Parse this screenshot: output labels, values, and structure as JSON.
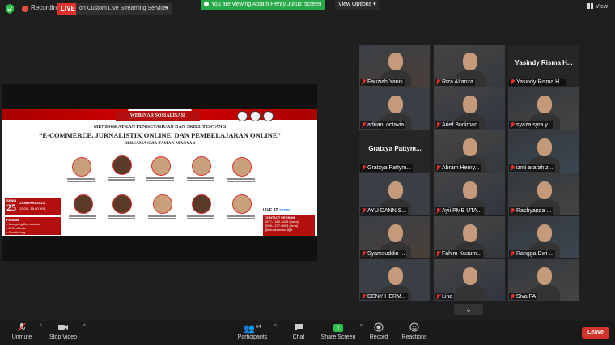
{
  "topbar": {
    "recording_label": "Recording",
    "live_badge": "LIVE",
    "live_service": "on Custom Live Streaming Service",
    "viewing_banner": "You are viewing Abram Henry Julius' screen",
    "view_options": "View Options",
    "view_label": "View"
  },
  "poster": {
    "badge": "WEBINAR SOSIALISASI",
    "line1": "MENINGKATKAN PENGETAHUAN DAN SKILL TENTANG",
    "line2": "“E-COMMERCE, JURNALISTIK ONLINE, DAN PEMBELAJARAN ONLINE”",
    "line3": "BERSAMA SMA TAMAN MADYA 1",
    "senin": "SENIN",
    "day": "25",
    "month": "JANUARI 2021",
    "time": "13.00 - 15.00 WIB",
    "fasilitas_title": "Fasilitas",
    "fasilitas": [
      "Ilmu yang Bermanfaat",
      "E-Certificate",
      "Goodie bag"
    ],
    "live_at": "LIVE AT",
    "zoom": "zoom",
    "contact_title": "CONTACT PERSON",
    "contact_lines": [
      "0877-7410-4405 (Juria)",
      "0895-1277-0505 (Irma)",
      "@himakomsta15jkt"
    ]
  },
  "gallery": [
    {
      "name": "Fauziah Yanis",
      "muted": true
    },
    {
      "name": "Riza Alfariza",
      "muted": true
    },
    {
      "name": "Yasindy Risma H...",
      "muted": true,
      "no_video": true
    },
    {
      "name": "adriani octavia",
      "muted": true
    },
    {
      "name": "Arief Budiman",
      "muted": true
    },
    {
      "name": "syaza syra y...",
      "muted": true
    },
    {
      "name": "Gratxya Pattym...",
      "muted": true,
      "no_video": true
    },
    {
      "name": "Abram Henry...",
      "muted": true
    },
    {
      "name": "izmi arafah z...",
      "muted": true
    },
    {
      "name": "AYU DANNIS...",
      "muted": true
    },
    {
      "name": "Ayii PMB UTA...",
      "muted": true
    },
    {
      "name": "Rachyanda ...",
      "muted": true
    },
    {
      "name": "Syamsuddin ...",
      "muted": true
    },
    {
      "name": "Fahim Kusum...",
      "muted": true
    },
    {
      "name": "Rangga Dwi ...",
      "muted": true
    },
    {
      "name": "DENY HERM...",
      "muted": true
    },
    {
      "name": "Lina",
      "muted": true
    },
    {
      "name": "Siva FA",
      "muted": true,
      "speaking": true
    }
  ],
  "toolbar": {
    "unmute": "Unmute",
    "stop_video": "Stop Video",
    "participants": "Participants",
    "participants_count": "64",
    "chat": "Chat",
    "share_screen": "Share Screen",
    "record": "Record",
    "reactions": "Reactions",
    "leave": "Leave"
  },
  "colors": {
    "live_red": "#e0312f",
    "banner_green": "#29a84a",
    "share_green": "#2fbf4e",
    "speaker_highlight": "#c7e65a",
    "leave_red": "#d0342c"
  }
}
